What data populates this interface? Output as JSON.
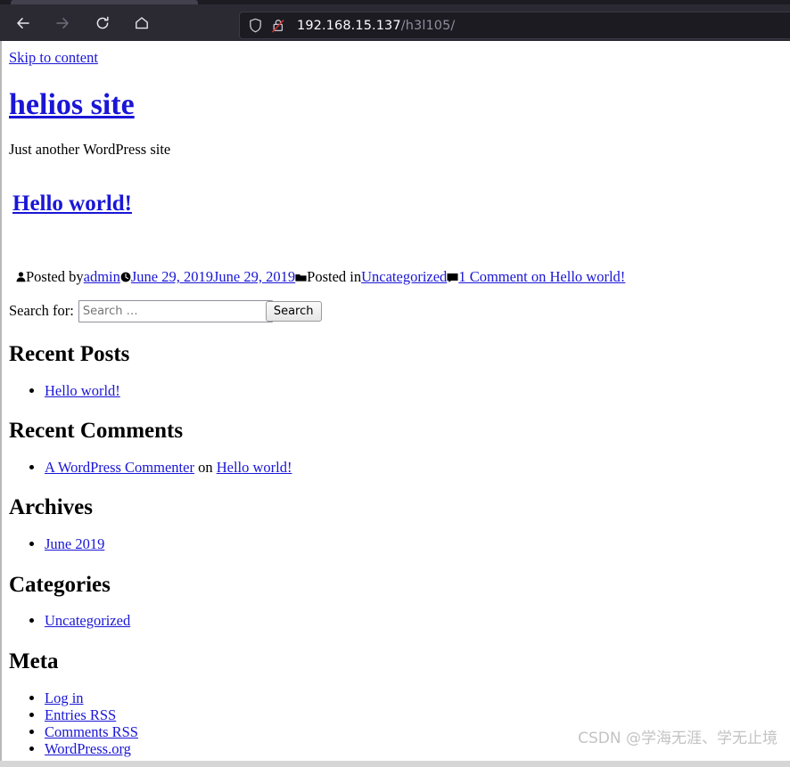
{
  "browser": {
    "nav": {
      "back_label": "Back",
      "forward_label": "Forward",
      "reload_label": "Reload",
      "home_label": "Home"
    },
    "url_bar": {
      "host": "192.168.15.137",
      "path": "/h3l105/",
      "shield_icon": "shield-icon",
      "lock_icon": "lock-crossed-insecure-icon"
    },
    "colors": {
      "chrome_bg": "#2b2a33",
      "tabstrip_bg": "#1c1b22",
      "urlbar_bg": "#1c1b22",
      "url_host_color": "#fbfbfe",
      "url_path_color": "#8f8f9d",
      "insecure_strike": "#d93030"
    }
  },
  "page": {
    "skip_link": "Skip to content",
    "site_title": "helios site",
    "site_description": "Just another WordPress site",
    "post": {
      "title": "Hello world!",
      "meta": {
        "author_icon": "person-icon",
        "posted_by_label": "Posted by",
        "author": "admin",
        "time_icon": "clock-icon",
        "date_published": "June 29, 2019",
        "date_modified": "June 29, 2019",
        "category_icon": "folder-icon",
        "posted_in_label": "Posted in",
        "category": "Uncategorized",
        "comment_icon": "comment-bubble-icon",
        "comments": "1 Comment on Hello world!"
      }
    },
    "search": {
      "label": "Search for:",
      "placeholder": "Search …",
      "value": "",
      "button": "Search"
    },
    "widgets": [
      {
        "title": "Recent Posts",
        "items": [
          {
            "text": "Hello world!",
            "link": true
          }
        ]
      },
      {
        "title": "Recent Comments",
        "items": [
          {
            "text": "A WordPress Commenter",
            "link": true,
            "suffix": " on ",
            "second": "Hello world!"
          }
        ]
      },
      {
        "title": "Archives",
        "items": [
          {
            "text": "June 2019",
            "link": true
          }
        ]
      },
      {
        "title": "Categories",
        "items": [
          {
            "text": "Uncategorized",
            "link": true
          }
        ]
      },
      {
        "title": "Meta",
        "items": [
          {
            "text": "Log in",
            "link": true
          },
          {
            "text": "Entries RSS",
            "link": true
          },
          {
            "text": "Comments RSS",
            "link": true
          },
          {
            "text": "WordPress.org",
            "link": true
          }
        ]
      }
    ],
    "link_color": "#1a16d6"
  },
  "watermark": "CSDN @学海无涯、学无止境"
}
